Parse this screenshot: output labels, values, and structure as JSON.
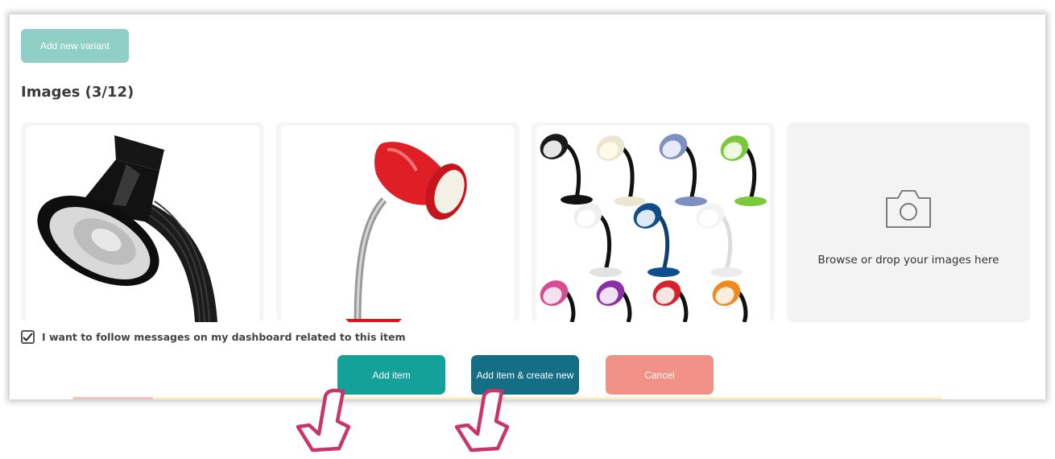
{
  "variant": {
    "button_label": "Add new variant"
  },
  "images": {
    "title": "Images (3/12)",
    "tiles": [
      {
        "icon": "black-desk-lamp-photo"
      },
      {
        "icon": "red-desk-lamp-photo"
      },
      {
        "icon": "multicolor-desk-lamps-photo"
      }
    ],
    "upload_text": "Browse or drop your images here",
    "upload_icon": "camera-icon"
  },
  "follow": {
    "label": "I want to follow messages on my dashboard related to this item",
    "checked": true
  },
  "actions": {
    "add_item": "Add item",
    "add_item_create_new": "Add item & create new",
    "cancel": "Cancel"
  },
  "colors": {
    "variant_button": "#8fcfc5",
    "add_item": "#13a19a",
    "add_item_create_new": "#136e86",
    "cancel": "#f19187",
    "pointer": "#c8356b"
  }
}
